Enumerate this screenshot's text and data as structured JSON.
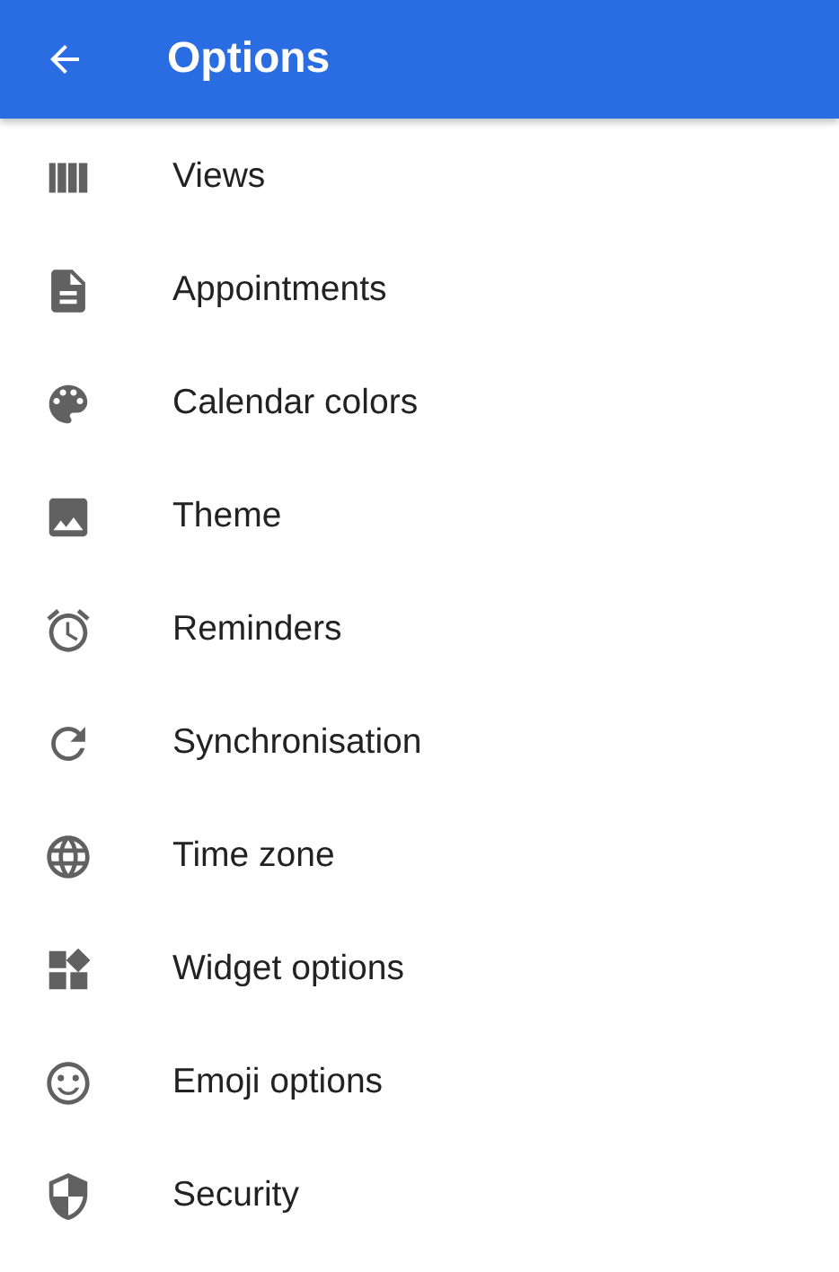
{
  "app_bar": {
    "title": "Options"
  },
  "items": [
    {
      "label": "Views",
      "kind": "views"
    },
    {
      "label": "Appointments",
      "kind": "document"
    },
    {
      "label": "Calendar colors",
      "kind": "palette"
    },
    {
      "label": "Theme",
      "kind": "image"
    },
    {
      "label": "Reminders",
      "kind": "alarm"
    },
    {
      "label": "Synchronisation",
      "kind": "refresh"
    },
    {
      "label": "Time zone",
      "kind": "globe"
    },
    {
      "label": "Widget options",
      "kind": "widgets"
    },
    {
      "label": "Emoji options",
      "kind": "emoji"
    },
    {
      "label": "Security",
      "kind": "shield"
    }
  ]
}
